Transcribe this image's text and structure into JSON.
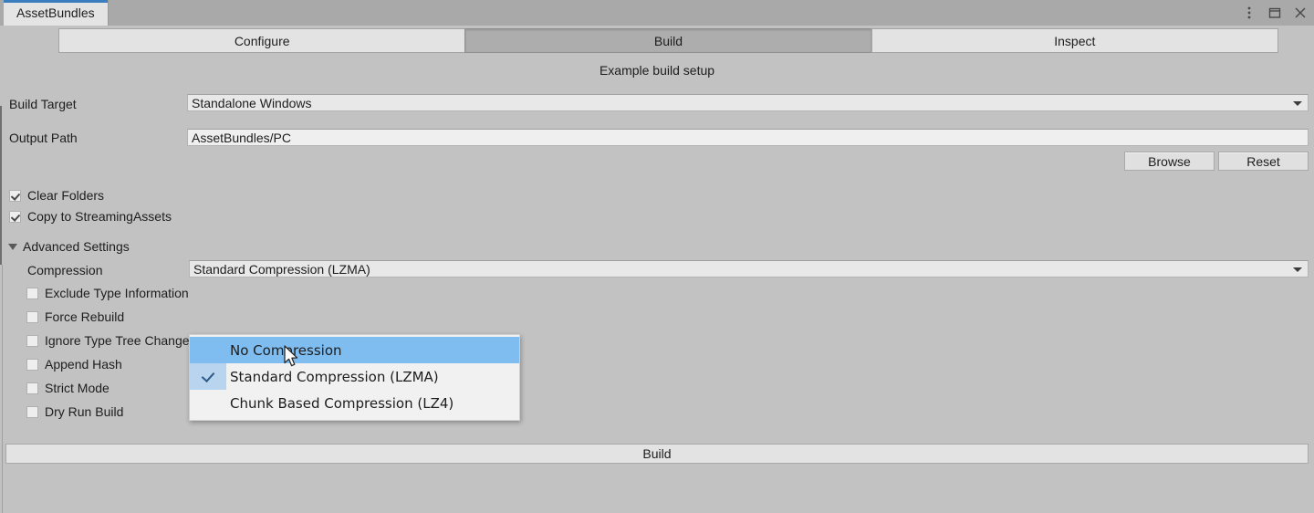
{
  "window": {
    "tab_title": "AssetBundles",
    "controls": [
      {
        "name": "menu-icon",
        "glyph": "⋮"
      },
      {
        "name": "maximize-icon",
        "glyph": "□"
      },
      {
        "name": "close-icon",
        "glyph": "✕"
      }
    ]
  },
  "mode_tabs": [
    {
      "label": "Configure",
      "selected": false
    },
    {
      "label": "Build",
      "selected": true
    },
    {
      "label": "Inspect",
      "selected": false
    }
  ],
  "caption": "Example build setup",
  "fields": {
    "build_target_label": "Build Target",
    "build_target_value": "Standalone Windows",
    "output_path_label": "Output Path",
    "output_path_value": "AssetBundles/PC"
  },
  "buttons": {
    "browse": "Browse",
    "reset": "Reset",
    "build": "Build"
  },
  "toggles": [
    {
      "label": "Clear Folders",
      "checked": true
    },
    {
      "label": "Copy to StreamingAssets",
      "checked": true
    }
  ],
  "advanced": {
    "foldout_label": "Advanced Settings",
    "expanded": true,
    "compression_label": "Compression",
    "compression_value": "Standard Compression (LZMA)",
    "options": [
      {
        "label": "Exclude Type Information",
        "checked": false
      },
      {
        "label": "Force Rebuild",
        "checked": false
      },
      {
        "label": "Ignore Type Tree Changes",
        "checked": false
      },
      {
        "label": "Append Hash",
        "checked": false
      },
      {
        "label": "Strict Mode",
        "checked": false
      },
      {
        "label": "Dry Run Build",
        "checked": false
      }
    ]
  },
  "dropdown": {
    "open": true,
    "items": [
      {
        "label": "No Compression",
        "checked": false,
        "highlighted": true
      },
      {
        "label": "Standard Compression (LZMA)",
        "checked": true,
        "highlighted": false
      },
      {
        "label": "Chunk Based Compression (LZ4)",
        "checked": false,
        "highlighted": false
      }
    ]
  },
  "colors": {
    "background": "#c2c2c2",
    "titlebar": "#a9a9a9",
    "tab_active_accent": "#3a7ebf",
    "selected_tab": "#adadad",
    "popup_highlight": "#7fbdf0",
    "popup_check_gutter": "#b8d4ee"
  }
}
